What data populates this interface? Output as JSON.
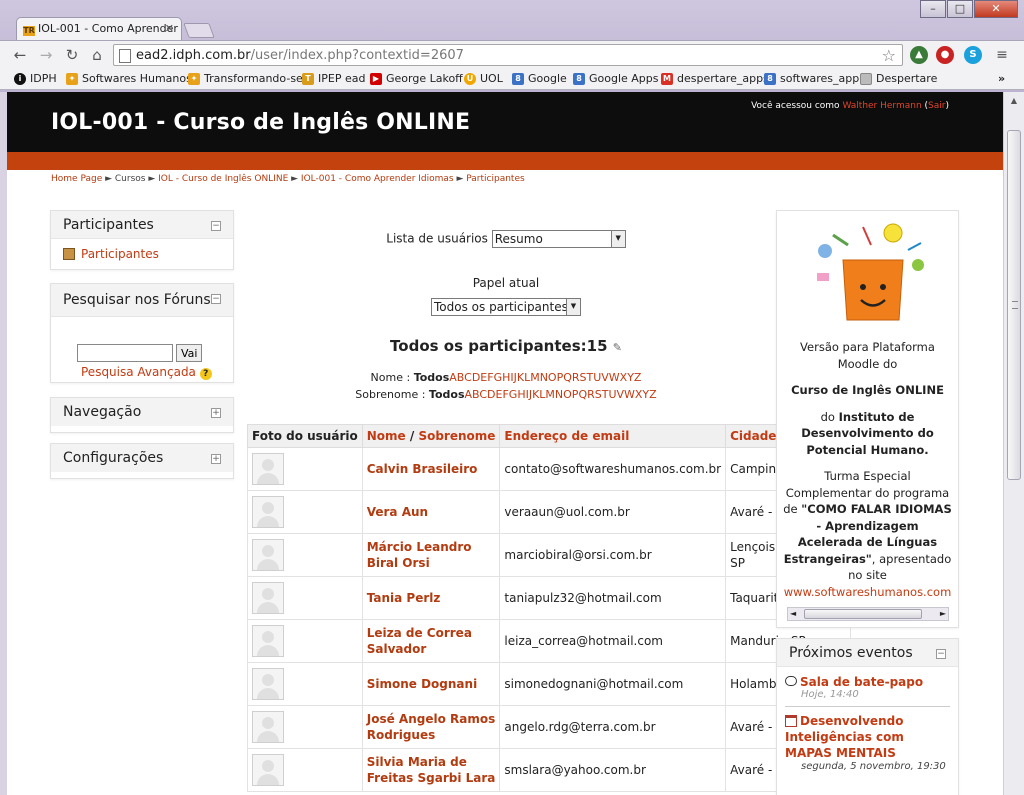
{
  "browser": {
    "tab_title": "IOL-001 - Como Aprender",
    "url_host": "ead2.idph.com.br",
    "url_path": "/user/index.php?contextid=2607",
    "window_buttons": [
      "–",
      "□",
      "✕"
    ],
    "bookmarks": [
      "IDPH",
      "Softwares Humanos",
      "Transformando-se",
      "IPEP ead",
      "George Lakoff",
      "UOL",
      "Google",
      "Google Apps",
      "despertare_apps",
      "softwares_app",
      "Despertare"
    ]
  },
  "site": {
    "course_title": "IOL-001 - Curso de Inglês ONLINE",
    "login_prefix": "Você acessou como",
    "login_user": "Walther Hermann",
    "login_logout": "Sair",
    "breadcrumb": [
      "Home Page",
      "Cursos",
      "IOL - Curso de Inglês ONLINE",
      "IOL-001 - Como Aprender Idiomas",
      "Participantes"
    ]
  },
  "left": {
    "participants_title": "Participantes",
    "participants_link": "Participantes",
    "search_title": "Pesquisar nos Fóruns",
    "search_value": "",
    "search_button": "Vai",
    "advanced_search": "Pesquisa Avançada",
    "nav_title": "Navegação",
    "config_title": "Configurações"
  },
  "main": {
    "list_label": "Lista de usuários",
    "list_value": "Resumo",
    "role_label": "Papel atual",
    "role_value": "Todos os participantes",
    "count_label": "Todos os participantes:",
    "count_value": "15",
    "name_filter_label": "Nome :",
    "surname_filter_label": "Sobrenome :",
    "all": "Todos",
    "letters": "ABCDEFGHIJKLMNOPQRSTUVWXYZ",
    "table_headers": {
      "photo": "Foto do usuário",
      "name": "Nome",
      "sep": "/",
      "surname": "Sobrenome",
      "email": "Endereço de email",
      "city": "Cidade/Município"
    },
    "rows": [
      {
        "name": "Calvin Brasileiro",
        "email": "contato@softwareshumanos.com.br",
        "city": "Campinas - SP"
      },
      {
        "name": "Vera Aun",
        "email": "veraaun@uol.com.br",
        "city": "Avaré - SP"
      },
      {
        "name": "Márcio Leandro Biral Orsi",
        "email": "marciobiral@orsi.com.br",
        "city": "Lençois Paulista - SP"
      },
      {
        "name": "Tania Perlz",
        "email": "taniapulz32@hotmail.com",
        "city": "Taquarituba - SP"
      },
      {
        "name": "Leiza de Correa Salvador",
        "email": "leiza_correa@hotmail.com",
        "city": "Manduri - SP"
      },
      {
        "name": "Simone Dognani",
        "email": "simonedognani@hotmail.com",
        "city": "Holambra - SP"
      },
      {
        "name": "José Angelo Ramos Rodrigues",
        "email": "angelo.rdg@terra.com.br",
        "city": "Avaré - SP"
      },
      {
        "name": "Silvia Maria de Freitas Sgarbi Lara",
        "email": "smslara@yahoo.com.br",
        "city": "Avaré - SP"
      }
    ]
  },
  "right": {
    "version_line1": "Versão para Plataforma",
    "version_line2": "Moodle do",
    "course_bold": "Curso de Inglês ONLINE",
    "institute_prefix": "do",
    "institute_bold": "Instituto de Desenvolvimento do Potencial Humano.",
    "special1": "Turma Especial",
    "special2": "Complementar do programa",
    "special3_prefix": "de",
    "special3_bold": "\"COMO FALAR IDIOMAS - Aprendizagem Acelerada de Línguas Estrangeiras\"",
    "special4": ", apresentado no site",
    "site_link": "www.softwareshumanos.com",
    "events_title": "Próximos eventos",
    "event1_title": "Sala de bate-papo",
    "event1_time": "Hoje, 14:40",
    "event2_title": "Desenvolvendo Inteligências com MAPAS MENTAIS",
    "event2_time": "segunda, 5 novembro, 19:30"
  }
}
